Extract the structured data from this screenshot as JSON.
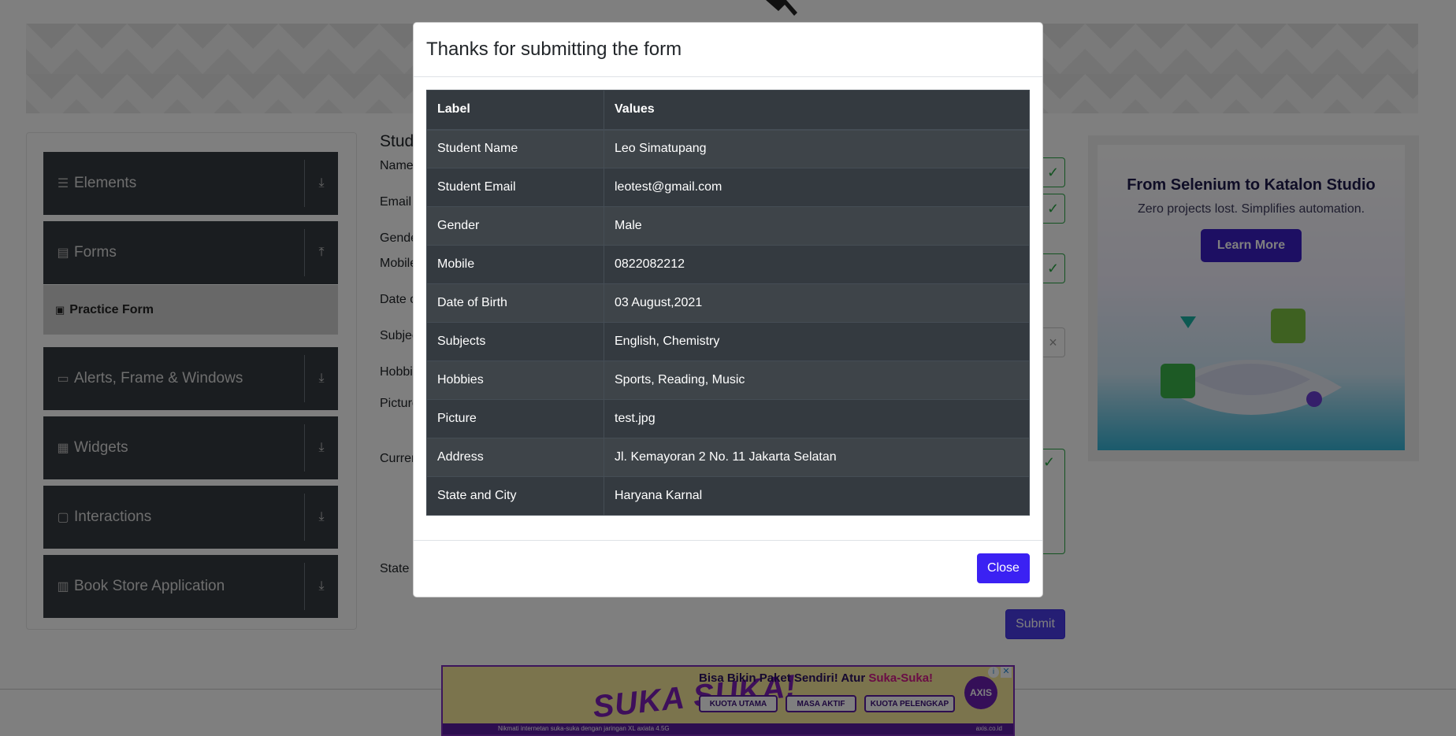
{
  "sidebar": {
    "groups": [
      {
        "label": "Elements",
        "icon": "list-icon",
        "arrow": "download-arrow-icon"
      },
      {
        "label": "Forms",
        "icon": "document-icon",
        "arrow": "upload-arrow-icon"
      },
      {
        "label": "Alerts, Frame & Windows",
        "icon": "window-icon",
        "arrow": "download-arrow-icon"
      },
      {
        "label": "Widgets",
        "icon": "widgets-icon",
        "arrow": "download-arrow-icon"
      },
      {
        "label": "Interactions",
        "icon": "interactions-icon",
        "arrow": "download-arrow-icon"
      },
      {
        "label": "Book Store Application",
        "icon": "books-icon",
        "arrow": "download-arrow-icon"
      }
    ],
    "active_item": "Practice Form"
  },
  "form": {
    "title_partial": "Stud",
    "labels": {
      "name": "Name",
      "email": "Email",
      "gender": "Gende",
      "mobile": "Mobile",
      "dob": "Date o",
      "subjects": "Subjec",
      "hobbies": "Hobbi",
      "picture": "Picture",
      "address": "Curren",
      "state": "State"
    },
    "submit_label": "Submit"
  },
  "ad_right": {
    "title": "From Selenium to Katalon Studio",
    "subtitle": "Zero projects lost. Simplifies automation.",
    "button": "Learn More"
  },
  "ad_bottom": {
    "headline_prefix": "Bisa Bikin Paket Sendiri! Atur ",
    "headline_highlight": "Suka-Suka!",
    "big_text": "SUKA SUKA!",
    "tags": [
      "KUOTA UTAMA",
      "MASA AKTIF",
      "KUOTA PELENGKAP"
    ],
    "brand": "AXIS",
    "strip": "Nikmati internetan suka-suka dengan jaringan XL axiata 4.5G",
    "site": "axis.co.id"
  },
  "modal": {
    "title": "Thanks for submitting the form",
    "headers": [
      "Label",
      "Values"
    ],
    "rows": [
      {
        "label": "Student Name",
        "value": "Leo Simatupang"
      },
      {
        "label": "Student Email",
        "value": "leotest@gmail.com"
      },
      {
        "label": "Gender",
        "value": "Male"
      },
      {
        "label": "Mobile",
        "value": "0822082212"
      },
      {
        "label": "Date of Birth",
        "value": "03 August,2021"
      },
      {
        "label": "Subjects",
        "value": "English, Chemistry"
      },
      {
        "label": "Hobbies",
        "value": "Sports, Reading, Music"
      },
      {
        "label": "Picture",
        "value": "test.jpg"
      },
      {
        "label": "Address",
        "value": "Jl. Kemayoran 2 No. 11 Jakarta Selatan"
      },
      {
        "label": "State and City",
        "value": "Haryana Karnal"
      }
    ],
    "close_label": "Close"
  }
}
